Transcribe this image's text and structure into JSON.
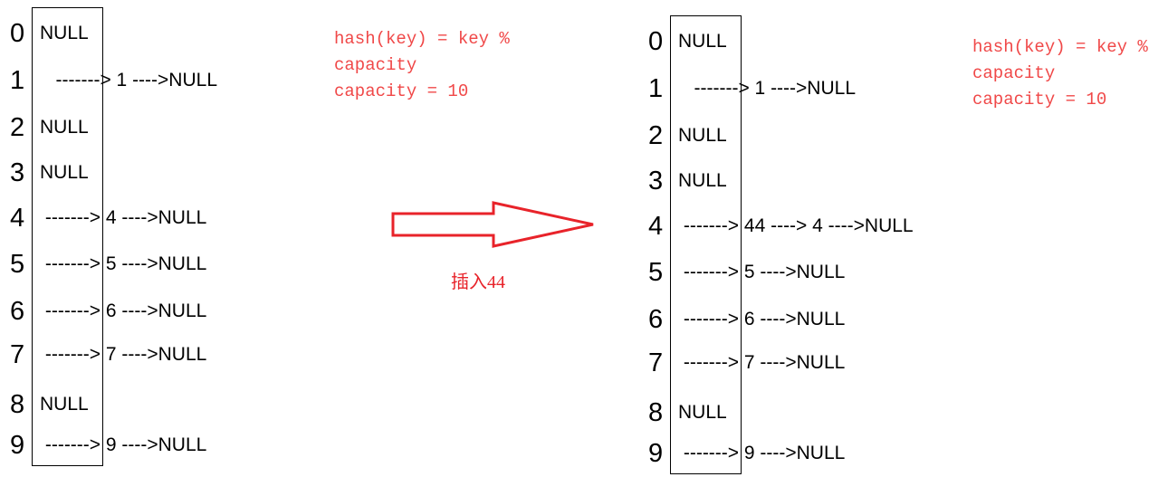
{
  "before": {
    "indices": [
      "0",
      "1",
      "2",
      "3",
      "4",
      "5",
      "6",
      "7",
      "8",
      "9"
    ],
    "cells": [
      "NULL",
      "   -------> 1 ---->NULL",
      "NULL",
      "NULL",
      " -------> 4 ---->NULL",
      " -------> 5 ---->NULL",
      " -------> 6 ---->NULL",
      " -------> 7 ---->NULL",
      "NULL",
      " -------> 9 ---->NULL"
    ]
  },
  "after": {
    "indices": [
      "0",
      "1",
      "2",
      "3",
      "4",
      "5",
      "6",
      "7",
      "8",
      "9"
    ],
    "cells": [
      "NULL",
      "   -------> 1 ---->NULL",
      "NULL",
      "NULL",
      " -------> 44 ----> 4 ---->NULL",
      " -------> 5 ---->NULL",
      " -------> 6 ---->NULL",
      " -------> 7 ---->NULL",
      "NULL",
      " -------> 9 ---->NULL"
    ]
  },
  "note": {
    "line1": "hash(key) = key %",
    "line2": "capacity",
    "line3": "capacity = 10"
  },
  "arrow": {
    "label": "插入44",
    "color": "#e8232a"
  },
  "colors": {
    "note": "#f04848",
    "arrow": "#e8232a"
  }
}
